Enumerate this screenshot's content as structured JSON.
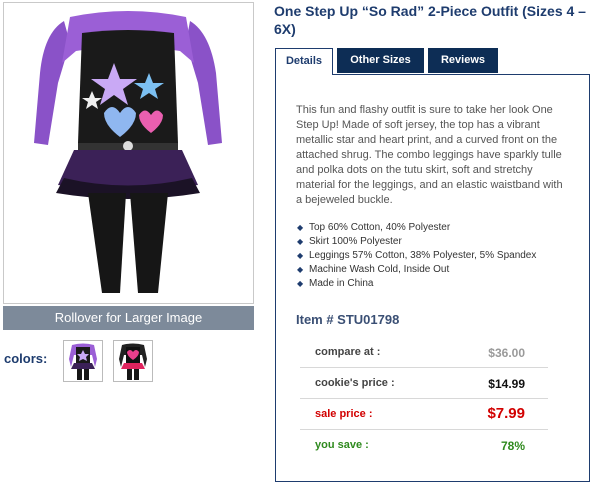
{
  "product": {
    "title": "One Step Up “So Rad” 2-Piece Outfit (Sizes 4 – 6X)",
    "rollover_label": "Rollover for Larger Image",
    "colors_label": "colors:",
    "swatches": [
      "purple-outfit",
      "black-outfit"
    ]
  },
  "tabs": [
    {
      "label": "Details",
      "active": true
    },
    {
      "label": "Other Sizes",
      "active": false
    },
    {
      "label": "Reviews",
      "active": false
    }
  ],
  "details": {
    "description": "This fun and flashy outfit is sure to take her look One Step Up! Made of soft jersey, the top has a vibrant metallic star and heart print, and a curved front on the attached shrug. The combo leggings have sparkly tulle and polka dots on the tutu skirt, soft and stretchy material for the leggings, and an elastic waistband with a bejeweled buckle.",
    "features": [
      "Top 60% Cotton, 40% Polyester",
      "Skirt 100% Polyester",
      "Leggings 57% Cotton, 38% Polyester, 5% Spandex",
      "Machine Wash Cold, Inside Out",
      "Made in China"
    ],
    "item_number": "Item # STU01798"
  },
  "pricing": {
    "compare_label": "compare at :",
    "compare_value": "$36.00",
    "cookie_label": "cookie's price :",
    "cookie_value": "$14.99",
    "sale_label": "sale price :",
    "sale_value": "$7.99",
    "save_label": "you save :",
    "save_value": "78%"
  },
  "colors": {
    "brand_navy": "#1e3c6e",
    "tab_dark": "#0d2d55",
    "sale_red": "#d20000",
    "save_green": "#2f8a1e"
  }
}
